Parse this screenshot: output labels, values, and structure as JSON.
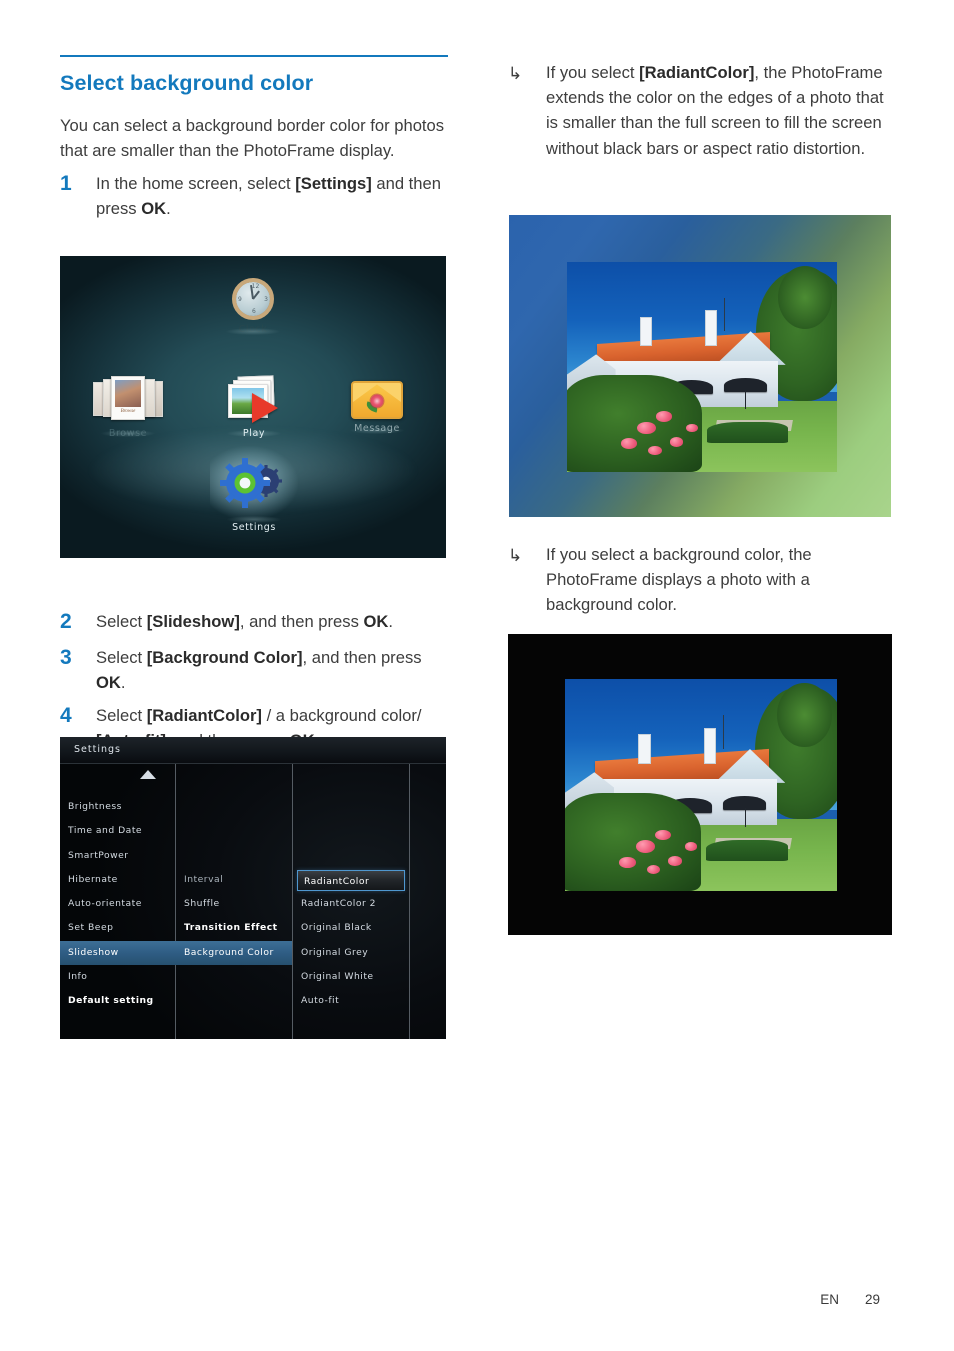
{
  "page": {
    "heading": "Select background color",
    "intro": "You can select a background border color for photos that are smaller than the PhotoFrame display.",
    "footer_language": "EN",
    "footer_page_number": "29",
    "accent_color": "#1379bd",
    "text_color": "#3d3d3d"
  },
  "steps": [
    {
      "num": "1",
      "parts": [
        {
          "text": "In the home screen, select ",
          "bold": false
        },
        {
          "text": "[Settings]",
          "bold": true
        },
        {
          "text": " and then press ",
          "bold": false
        },
        {
          "text": "OK",
          "bold": true
        },
        {
          "text": ".",
          "bold": false
        }
      ]
    },
    {
      "num": "2",
      "parts": [
        {
          "text": "Select ",
          "bold": false
        },
        {
          "text": "[Slideshow]",
          "bold": true
        },
        {
          "text": ", and then press ",
          "bold": false
        },
        {
          "text": "OK",
          "bold": true
        },
        {
          "text": ".",
          "bold": false
        }
      ]
    },
    {
      "num": "3",
      "parts": [
        {
          "text": "Select ",
          "bold": false
        },
        {
          "text": "[Background Color]",
          "bold": true
        },
        {
          "text": ", and then press ",
          "bold": false
        },
        {
          "text": "OK",
          "bold": true
        },
        {
          "text": ".",
          "bold": false
        }
      ]
    },
    {
      "num": "4",
      "parts": [
        {
          "text": "Select ",
          "bold": false
        },
        {
          "text": "[RadiantColor]",
          "bold": true
        },
        {
          "text": " / a background color/ ",
          "bold": false
        },
        {
          "text": "[Auto-fit]",
          "bold": true
        },
        {
          "text": ", and then press ",
          "bold": false
        },
        {
          "text": "OK",
          "bold": true
        },
        {
          "text": ".",
          "bold": false
        }
      ]
    }
  ],
  "notes": [
    {
      "glyph": "↳",
      "glyph_name": "arrow-bullet-icon",
      "parts": [
        {
          "text": "If you select ",
          "bold": false
        },
        {
          "text": "[RadiantColor]",
          "bold": true
        },
        {
          "text": ", the PhotoFrame extends the color on the edges of a photo that is smaller than the full screen to fill the screen without black bars or aspect ratio distortion.",
          "bold": false
        }
      ]
    },
    {
      "glyph": "↳",
      "glyph_name": "arrow-bullet-icon",
      "parts": [
        {
          "text": "If you select a background color, the PhotoFrame displays a photo with a background color.",
          "bold": false
        }
      ]
    }
  ],
  "home_screen": {
    "items": [
      {
        "label": "Clock",
        "icon": "clock-icon",
        "selected": false
      },
      {
        "label": "Browse",
        "icon": "browse-icon",
        "selected": false
      },
      {
        "label": "Play",
        "icon": "play-icon",
        "selected": false
      },
      {
        "label": "Message",
        "icon": "message-icon",
        "selected": false
      },
      {
        "label": "Settings",
        "icon": "settings-gear-icon",
        "selected": true
      }
    ]
  },
  "settings_screen": {
    "title": "Settings",
    "scroll_up_indicator": "▲",
    "column1": [
      {
        "label": "Brightness",
        "selected": false
      },
      {
        "label": "Time and Date",
        "selected": false
      },
      {
        "label": "SmartPower",
        "selected": false
      },
      {
        "label": "Hibernate",
        "selected": false
      },
      {
        "label": "Auto-orientate",
        "selected": false
      },
      {
        "label": "Set Beep",
        "selected": false
      },
      {
        "label": "Slideshow",
        "selected": true
      },
      {
        "label": "Info",
        "selected": false
      },
      {
        "label": "Default setting",
        "selected": false
      }
    ],
    "column2": [
      {
        "label": "Interval",
        "selected": false
      },
      {
        "label": "Shuffle",
        "selected": false
      },
      {
        "label": "Transition Effect",
        "selected": false
      },
      {
        "label": "Background Color",
        "selected": true
      }
    ],
    "column3": [
      {
        "label": "RadiantColor",
        "selected": true
      },
      {
        "label": "RadiantColor 2",
        "selected": false
      },
      {
        "label": "Original Black",
        "selected": false
      },
      {
        "label": "Original Grey",
        "selected": false
      },
      {
        "label": "Original White",
        "selected": false
      },
      {
        "label": "Auto-fit",
        "selected": false
      }
    ],
    "highlight_color": "#2f5d84",
    "selection_border_color": "#4f97cf"
  },
  "photos": [
    {
      "name": "radiant-color-example",
      "caption_ref": "RadiantColor",
      "background_style": "radiant gradient blue to green"
    },
    {
      "name": "background-color-example",
      "caption_ref": "Original Black",
      "background_style": "solid black"
    }
  ]
}
